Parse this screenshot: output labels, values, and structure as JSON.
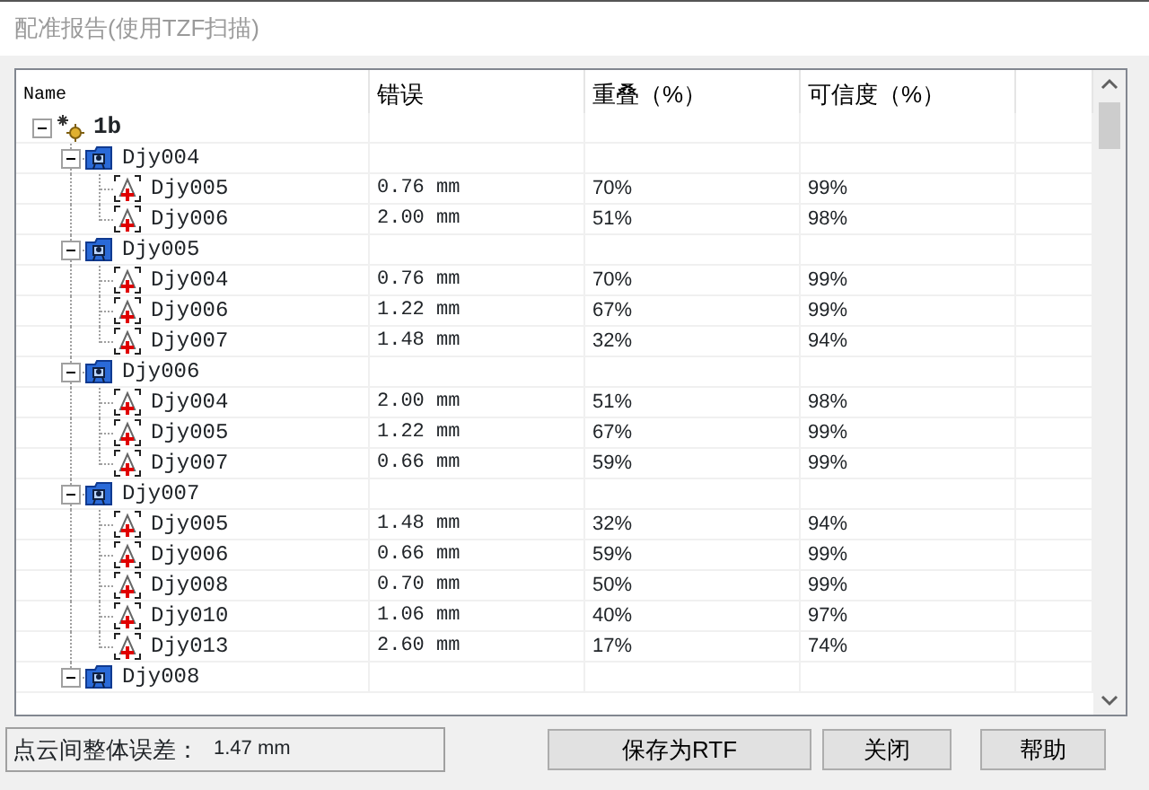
{
  "window": {
    "title": "配准报告(使用TZF扫描)"
  },
  "columns": [
    "Name",
    "错误",
    "重叠（%）",
    "可信度（%）"
  ],
  "tree": {
    "name": "1b",
    "kind": "root",
    "expanded": true,
    "children": [
      {
        "name": "Djy004",
        "kind": "group",
        "expanded": true,
        "children": [
          {
            "name": "Djy005",
            "kind": "scan",
            "error": "0.76 mm",
            "overlap": "70%",
            "confidence": "99%"
          },
          {
            "name": "Djy006",
            "kind": "scan",
            "error": "2.00 mm",
            "overlap": "51%",
            "confidence": "98%"
          }
        ]
      },
      {
        "name": "Djy005",
        "kind": "group",
        "expanded": true,
        "children": [
          {
            "name": "Djy004",
            "kind": "scan",
            "error": "0.76 mm",
            "overlap": "70%",
            "confidence": "99%"
          },
          {
            "name": "Djy006",
            "kind": "scan",
            "error": "1.22 mm",
            "overlap": "67%",
            "confidence": "99%"
          },
          {
            "name": "Djy007",
            "kind": "scan",
            "error": "1.48 mm",
            "overlap": "32%",
            "confidence": "94%"
          }
        ]
      },
      {
        "name": "Djy006",
        "kind": "group",
        "expanded": true,
        "children": [
          {
            "name": "Djy004",
            "kind": "scan",
            "error": "2.00 mm",
            "overlap": "51%",
            "confidence": "98%"
          },
          {
            "name": "Djy005",
            "kind": "scan",
            "error": "1.22 mm",
            "overlap": "67%",
            "confidence": "99%"
          },
          {
            "name": "Djy007",
            "kind": "scan",
            "error": "0.66 mm",
            "overlap": "59%",
            "confidence": "99%"
          }
        ]
      },
      {
        "name": "Djy007",
        "kind": "group",
        "expanded": true,
        "children": [
          {
            "name": "Djy005",
            "kind": "scan",
            "error": "1.48 mm",
            "overlap": "32%",
            "confidence": "94%"
          },
          {
            "name": "Djy006",
            "kind": "scan",
            "error": "0.66 mm",
            "overlap": "59%",
            "confidence": "99%"
          },
          {
            "name": "Djy008",
            "kind": "scan",
            "error": "0.70 mm",
            "overlap": "50%",
            "confidence": "99%"
          },
          {
            "name": "Djy010",
            "kind": "scan",
            "error": "1.06 mm",
            "overlap": "40%",
            "confidence": "97%"
          },
          {
            "name": "Djy013",
            "kind": "scan",
            "error": "2.60 mm",
            "overlap": "17%",
            "confidence": "74%"
          }
        ]
      },
      {
        "name": "Djy008",
        "kind": "group",
        "expanded": true
      }
    ]
  },
  "status": {
    "label": "点云间整体误差：",
    "value": "1.47 mm"
  },
  "buttons": [
    "保存为RTF",
    "关闭",
    "帮助"
  ]
}
